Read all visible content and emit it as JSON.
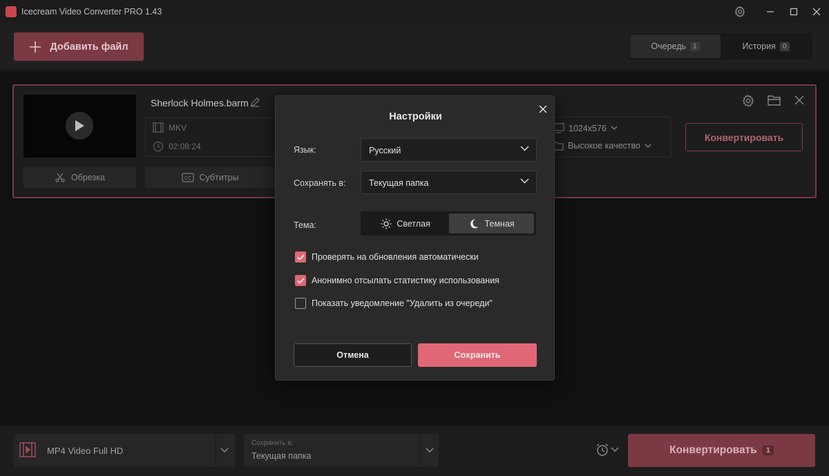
{
  "app": {
    "title": "Icecream Video Converter PRO 1.43"
  },
  "toolbar": {
    "add_file_label": "Добавить файл",
    "tabs": [
      {
        "label": "Очередь",
        "count": "1",
        "active": true
      },
      {
        "label": "История",
        "count": "0",
        "active": false
      }
    ]
  },
  "item": {
    "file_name": "Sherlock Holmes.barm",
    "format": "MKV",
    "duration": "02:08:24",
    "resolution": "1024x576",
    "quality": "Высокое качество",
    "trim_label": "Обрезка",
    "subtitles_label": "Субтитры",
    "convert_label": "Конвертировать"
  },
  "bottom": {
    "format_label": "MP4 Video Full HD",
    "save_caption": "Сохранить в:",
    "save_value": "Текущая папка",
    "convert_label": "Конвертировать",
    "convert_count": "1"
  },
  "dialog": {
    "title": "Настройки",
    "language_label": "Язык:",
    "language_value": "Русский",
    "save_to_label": "Сохранять в:",
    "save_to_value": "Текущая папка",
    "theme_label": "Тема:",
    "theme_light": "Светлая",
    "theme_dark": "Темная",
    "theme_selected": "dark",
    "checkboxes": [
      {
        "label": "Проверять на обновления автоматически",
        "checked": true
      },
      {
        "label": "Анонимно отсылать статистику использования",
        "checked": true
      },
      {
        "label": "Показать уведомление \"Удалить из очереди\"",
        "checked": false
      }
    ],
    "cancel_label": "Отмена",
    "save_label": "Сохранить"
  },
  "colors": {
    "accent": "#e06775",
    "accent_dim": "#7b3943",
    "background": "#1f1f1f",
    "dialog_bg": "#2a2a2a"
  },
  "icons": [
    "app-logo-icon",
    "settings-gear-icon",
    "minimize-icon",
    "maximize-icon",
    "close-icon",
    "plus-icon",
    "play-icon",
    "edit-pencil-icon",
    "film-icon",
    "clock-icon",
    "scissors-icon",
    "cc-icon",
    "monitor-icon",
    "folder-icon",
    "chevron-down-icon",
    "alarm-clock-icon",
    "sun-icon",
    "moon-icon",
    "check-icon"
  ]
}
